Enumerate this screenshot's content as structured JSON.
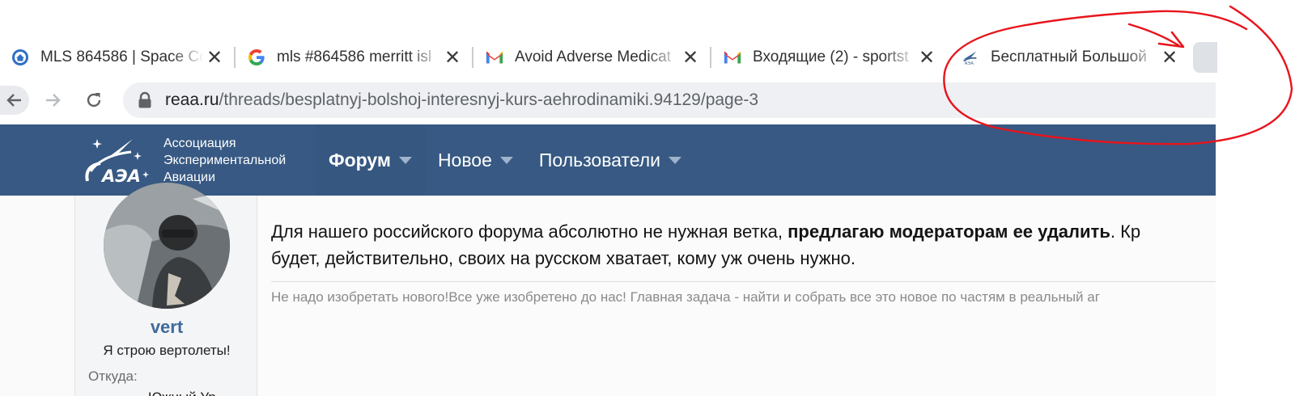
{
  "browser": {
    "tabs": [
      {
        "title": "MLS 864586 | Space Co",
        "favicon": "home-pin-icon",
        "active": false
      },
      {
        "title": "mls #864586 merritt isl",
        "favicon": "google-icon",
        "active": false
      },
      {
        "title": "Avoid Adverse Medicat",
        "favicon": "gmail-icon",
        "active": false
      },
      {
        "title": "Входящие (2) - sportst",
        "favicon": "gmail-icon",
        "active": false
      },
      {
        "title": "Бесплатный Большой",
        "favicon": "site-plane-icon",
        "active": true
      }
    ],
    "close_glyph": "✕",
    "url_host": "reaa.ru",
    "url_path": "/threads/besplatnyj-bolshoj-interesnyj-kurs-aehrodinamiki.94129/page-3"
  },
  "site": {
    "org_lines": [
      "Ассоциация",
      "Экспериментальной",
      "Авиации"
    ],
    "logo_text": "АЭА",
    "nav": [
      {
        "label": "Форум",
        "active": true
      },
      {
        "label": "Новое",
        "active": false
      },
      {
        "label": "Пользователи",
        "active": false
      }
    ],
    "colors": {
      "header": "#375983",
      "username": "#3d6a9b",
      "annotation": "#e8141c"
    }
  },
  "post": {
    "author": "vert",
    "author_title": "Я строю вертолеты!",
    "from_label": "Откуда:",
    "from_value": "Южный Ур",
    "text_plain_1": "Для нашего российского форума абсолютно не нужная ветка, ",
    "text_bold": "предлагаю модераторам ее удалить",
    "text_plain_2": ". Кр",
    "text_line_2": "будет, действительно, своих на русском хватает, кому уж очень нужно.",
    "signature": "Не надо изобретать нового!Все уже изобретено до нас! Главная задача - найти и  собрать  все это новое по частям  в реальный аг"
  }
}
